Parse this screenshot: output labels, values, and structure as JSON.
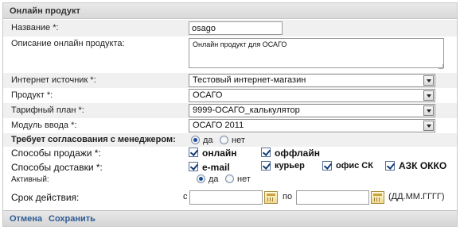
{
  "panel": {
    "title": "Онлайн продукт"
  },
  "form": {
    "name": {
      "label": "Название *:",
      "value": "osago"
    },
    "description": {
      "label": "Описание онлайн продукта:",
      "value": "Онлайн продукт для ОСАГО"
    },
    "source": {
      "label": "Интернет источник *:",
      "value": "Тестовый интернет-магазин"
    },
    "product": {
      "label": "Продукт *:",
      "value": "ОСАГО"
    },
    "tariff": {
      "label": "Тарифный план *:",
      "value": "9999-ОСАГО_калькулятор"
    },
    "module": {
      "label": "Модуль ввода *:",
      "value": "ОСАГО 2011"
    },
    "approval": {
      "label": "Требует согласования с менеджером:",
      "yes": "да",
      "no": "нет",
      "selected": "yes"
    },
    "sale_methods": {
      "label": "Способы продажи *:",
      "online": "онлайн",
      "offline": "оффлайн",
      "online_checked": true,
      "offline_checked": true
    },
    "delivery_methods": {
      "label": "Способы доставки *:",
      "email": "e-mail",
      "courier": "курьер",
      "office": "офис СК",
      "azs": "АЗК ОККО",
      "email_checked": true,
      "courier_checked": true,
      "office_checked": true,
      "azs_checked": true
    },
    "active": {
      "label": "Активный:",
      "yes": "да",
      "no": "нет",
      "selected": "yes"
    },
    "validity": {
      "label": "Срок действия:",
      "from": "с",
      "to": "по",
      "from_value": "",
      "to_value": "",
      "format": "(ДД.ММ.ГГГГ)"
    }
  },
  "footer": {
    "cancel": "Отмена",
    "save": "Сохранить"
  },
  "colors": {
    "link": "#2e5b94",
    "header": "#dedede",
    "check": "#123d7a"
  }
}
